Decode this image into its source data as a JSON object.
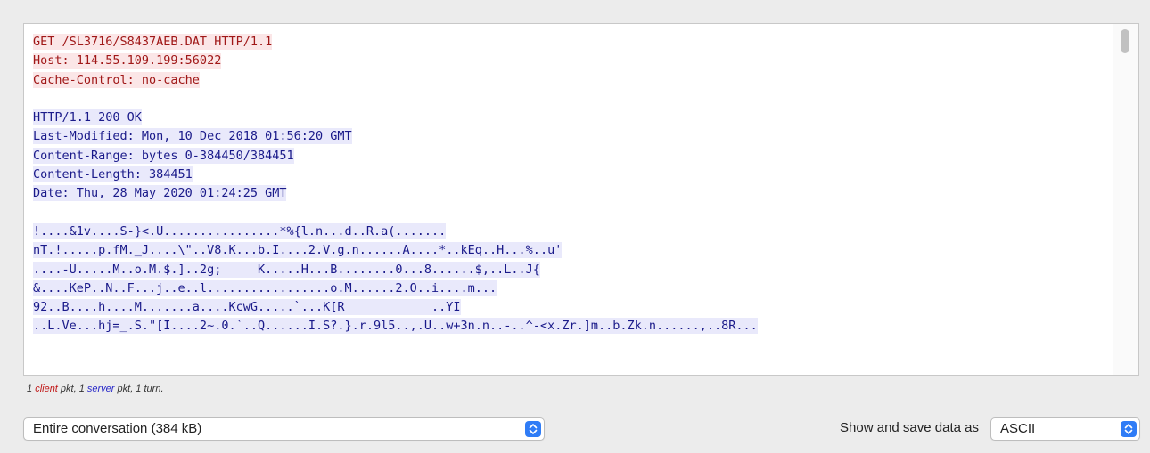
{
  "stream": {
    "client_request": [
      "GET /SL3716/S8437AEB.DAT HTTP/1.1",
      "Host: 114.55.109.199:56022",
      "Cache-Control: no-cache"
    ],
    "server_response": [
      "HTTP/1.1 200 OK",
      "Last-Modified: Mon, 10 Dec 2018 01:56:20 GMT",
      "Content-Range: bytes 0-384450/384451",
      "Content-Length: 384451",
      "Date: Thu, 28 May 2020 01:24:25 GMT"
    ],
    "server_body": [
      "!....&1v....S-}<.U................*%{l.n...d..R.a(.......",
      "nT.!.....p.fM._J....\\\"..V8.K...b.I....2.V.g.n......A....*..kEq..H...%..u'",
      "....-U.....M..o.M.$.]..2g;     K.....H...B........0...8......$,..L..J{",
      "&....KeP..N..F...j..e..l.................o.M......2.O..i....m...",
      "92..B....h....M.......a....KcwG.....`...K[R            ..YI",
      "..L.Ve...hj=_.S.\"[I....2~.0.`..Q......I.S?.}.r.9l5..,.U..w+3n.n..-..^-<x.Zr.]m..b.Zk.n......,..8R..."
    ]
  },
  "status": {
    "prefix": "1 ",
    "client_word": "client",
    "middle": " pkt, 1 ",
    "server_word": "server",
    "suffix": " pkt, 1 turn."
  },
  "controls": {
    "conversation_value": "Entire conversation (384 kB)",
    "save_as_label": "Show and save data as",
    "format_value": "ASCII"
  },
  "colors": {
    "client_text": "#a01818",
    "client_bg": "#fbe6e7",
    "server_text": "#1a1a8a",
    "server_bg": "#e9e9fb",
    "stepper": "#2f7cf6"
  }
}
